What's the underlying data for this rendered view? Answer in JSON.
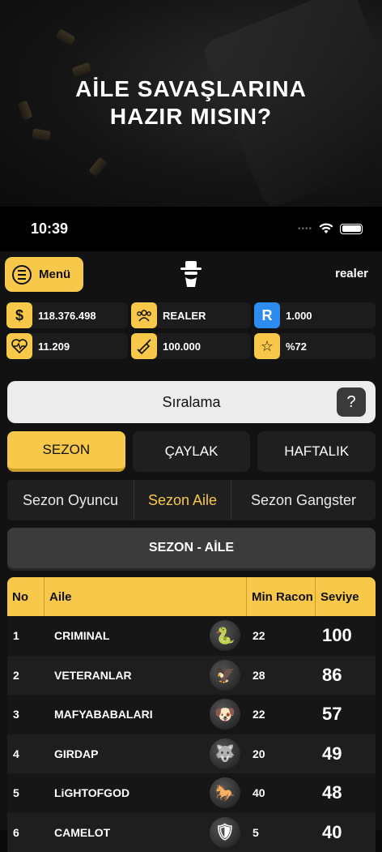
{
  "promo": {
    "title_line1": "AİLE SAVAŞLARINA",
    "title_line2": "HAZIR MISIN?"
  },
  "status_bar": {
    "time": "10:39"
  },
  "header": {
    "menu_label": "Menü",
    "username": "realer"
  },
  "stats": [
    {
      "icon": "dollar-icon",
      "glyph": "$",
      "value": "118.376.498",
      "color": "#f7c84a"
    },
    {
      "icon": "group-icon",
      "glyph": "👥",
      "value": "REALER",
      "color": "#f7c84a"
    },
    {
      "icon": "r-badge-icon",
      "glyph": "R",
      "value": "1.000",
      "color": "#2d8cf0"
    },
    {
      "icon": "heart-rate-icon",
      "glyph": "♥",
      "value": "11.209",
      "color": "#f7c84a"
    },
    {
      "icon": "bullet-icon",
      "glyph": "➶",
      "value": "100.000",
      "color": "#f7c84a"
    },
    {
      "icon": "star-icon",
      "glyph": "☆",
      "value": "%72",
      "color": "#f7c84a"
    }
  ],
  "page_title": "Sıralama",
  "help_glyph": "?",
  "tabs": [
    {
      "label": "SEZON",
      "active": true
    },
    {
      "label": "ÇAYLAK",
      "active": false
    },
    {
      "label": "HAFTALIK",
      "active": false
    }
  ],
  "subtabs": [
    {
      "label": "Sezon Oyuncu",
      "active": false
    },
    {
      "label": "Sezon Aile",
      "active": true
    },
    {
      "label": "Sezon Gangster",
      "active": false
    }
  ],
  "section_title": "SEZON - AİLE",
  "table": {
    "headers": [
      "No",
      "Aile",
      "Min Racon",
      "Seviye"
    ],
    "rows": [
      {
        "no": "1",
        "aile": "CRIMINAL",
        "min_racon": "22",
        "seviye": "100",
        "emblem": "snake-emblem-icon",
        "glyph": "🐍"
      },
      {
        "no": "2",
        "aile": "VETERANLAR",
        "min_racon": "28",
        "seviye": "86",
        "emblem": "eagle-emblem-icon",
        "glyph": "🦅"
      },
      {
        "no": "3",
        "aile": "MAFYABABALARI",
        "min_racon": "22",
        "seviye": "57",
        "emblem": "dog-emblem-icon",
        "glyph": "🐶"
      },
      {
        "no": "4",
        "aile": "GIRDAP",
        "min_racon": "20",
        "seviye": "49",
        "emblem": "wolf-emblem-icon",
        "glyph": "🐺"
      },
      {
        "no": "5",
        "aile": "LiGHTOFGOD",
        "min_racon": "40",
        "seviye": "48",
        "emblem": "horse-emblem-icon",
        "glyph": "🐎"
      },
      {
        "no": "6",
        "aile": "CAMELOT",
        "min_racon": "5",
        "seviye": "40",
        "emblem": "shield-emblem-icon",
        "glyph": "🛡"
      }
    ]
  }
}
